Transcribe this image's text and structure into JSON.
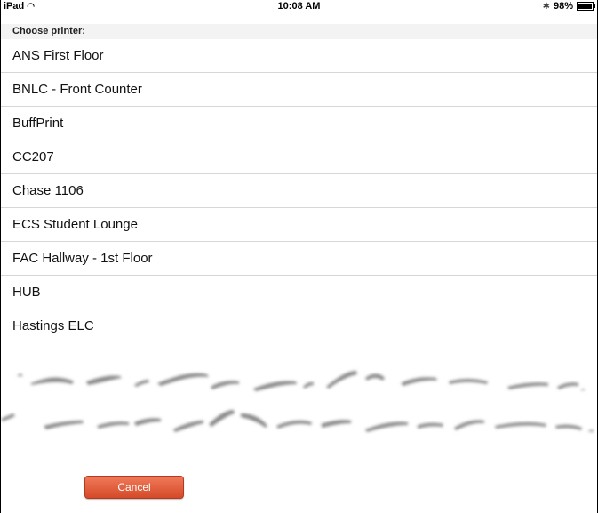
{
  "status_bar": {
    "device": "iPad",
    "time": "10:08 AM",
    "battery": "98%"
  },
  "header": {
    "title": "Choose printer:"
  },
  "printers": [
    {
      "label": "ANS First Floor"
    },
    {
      "label": "BNLC - Front Counter"
    },
    {
      "label": "BuffPrint"
    },
    {
      "label": "CC207"
    },
    {
      "label": "Chase 1106"
    },
    {
      "label": "ECS Student Lounge"
    },
    {
      "label": "FAC Hallway - 1st Floor"
    },
    {
      "label": "HUB"
    },
    {
      "label": "Hastings ELC"
    }
  ],
  "actions": {
    "cancel_label": "Cancel"
  },
  "colors": {
    "cancel_bg": "#e0563a",
    "header_bg": "#f3f3f3",
    "separator": "#d6d6d6"
  }
}
